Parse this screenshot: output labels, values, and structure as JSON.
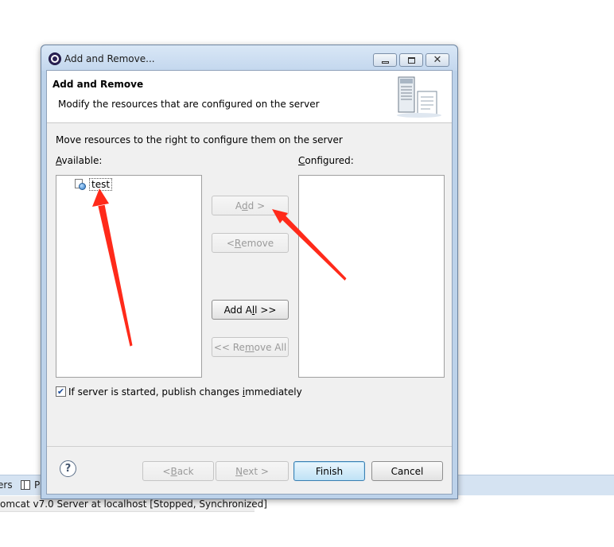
{
  "background": {
    "tab_servers": "ers",
    "tab_p": "P",
    "server_entry": "omcat v7.0 Server at localhost  [Stopped, Synchronized]"
  },
  "dialog": {
    "title": "Add and Remove...",
    "header": {
      "title": "Add and Remove",
      "description": "Modify the resources that are configured on the server"
    },
    "instruction": "Move resources to the right to configure them on the server",
    "available": {
      "label_mnemonic": "A",
      "label_rest": "vailable:",
      "items": [
        {
          "label": "test"
        }
      ]
    },
    "configured": {
      "label_mnemonic": "C",
      "label_rest": "onfigured:",
      "items": []
    },
    "buttons": {
      "add": {
        "pre": "A",
        "mn": "d",
        "post": "d >"
      },
      "remove": {
        "pre": "< ",
        "mn": "R",
        "post": "emove"
      },
      "add_all": {
        "pre": "Add A",
        "mn": "l",
        "post": "l >>"
      },
      "remove_all": {
        "pre": "<< Re",
        "mn": "m",
        "post": "ove All"
      }
    },
    "publish": {
      "checked": true,
      "pre": "If server is started, publish changes ",
      "mn": "i",
      "post": "mmediately"
    },
    "footer": {
      "help": "?",
      "back": {
        "pre": "< ",
        "mn": "B",
        "post": "ack"
      },
      "next": {
        "mn": "N",
        "post": "ext >"
      },
      "finish": "Finish",
      "cancel": "Cancel"
    }
  },
  "annotation_color": "#ff2a1a"
}
